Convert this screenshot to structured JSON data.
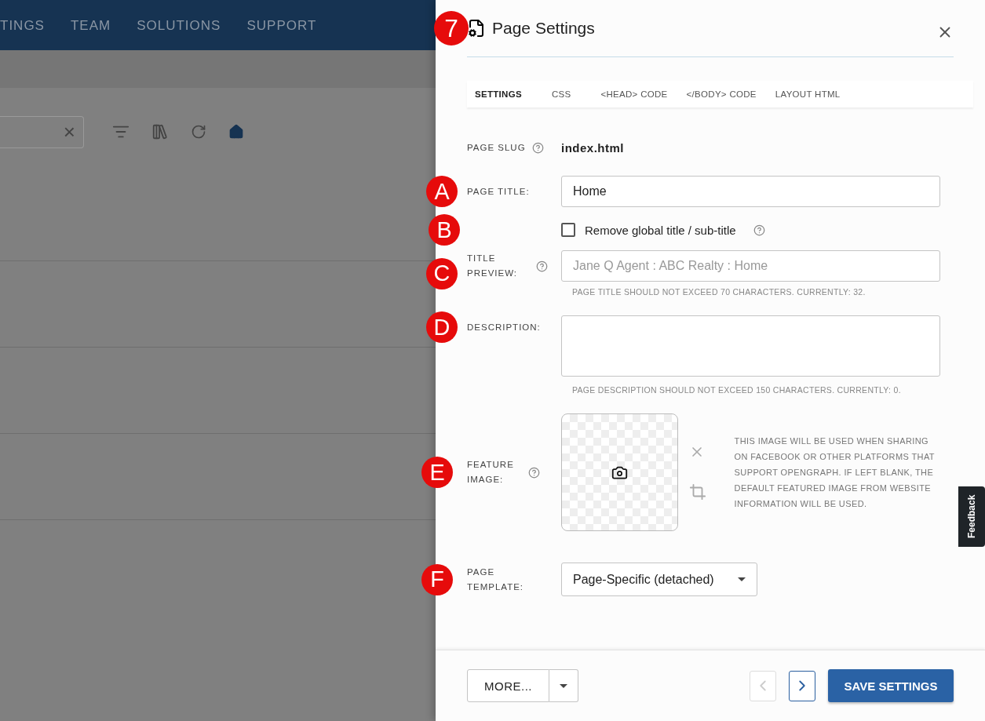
{
  "background": {
    "nav": [
      "TINGS",
      "TEAM",
      "SOLUTIONS",
      "SUPPORT"
    ],
    "search_field": {
      "clear": "×"
    }
  },
  "drawer": {
    "title": "Page Settings",
    "callout": "7",
    "tabs": [
      {
        "label": "SETTINGS",
        "selected": true
      },
      {
        "label": "CSS",
        "selected": false
      },
      {
        "label": "<HEAD> CODE",
        "selected": false
      },
      {
        "label": "</BODY> CODE",
        "selected": false
      },
      {
        "label": "LAYOUT HTML",
        "selected": false
      }
    ],
    "page_slug": {
      "label": "PAGE SLUG",
      "value": "index.html"
    },
    "page_title": {
      "label": "PAGE TITLE:",
      "value": "Home",
      "callout": "A"
    },
    "remove_global_title": {
      "label": "Remove global title / sub-title",
      "checked": false,
      "callout": "B"
    },
    "title_preview": {
      "label": "TITLE PREVIEW:",
      "placeholder": "Jane Q Agent : ABC Realty : Home",
      "hint": "PAGE TITLE SHOULD NOT EXCEED 70 CHARACTERS. CURRENTLY: 32.",
      "callout": "C"
    },
    "description": {
      "label": "DESCRIPTION:",
      "hint": "PAGE DESCRIPTION SHOULD NOT EXCEED 150 CHARACTERS. CURRENTLY: 0.",
      "callout": "D"
    },
    "feature_image": {
      "label": "FEATURE IMAGE:",
      "note": "THIS IMAGE WILL BE USED WHEN SHARING ON FACEBOOK OR OTHER PLATFORMS THAT SUPPORT OPENGRAPH. IF LEFT BLANK, THE DEFAULT FEATURED IMAGE FROM WEBSITE INFORMATION WILL BE USED.",
      "callout": "E"
    },
    "page_template": {
      "label": "PAGE TEMPLATE:",
      "value": "Page-Specific (detached)",
      "callout": "F"
    },
    "footer": {
      "more": "MORE...",
      "prev_disabled": true,
      "next_disabled": false,
      "save": "SAVE SETTINGS"
    }
  },
  "feedback_tab": {
    "label": "Feedback"
  }
}
